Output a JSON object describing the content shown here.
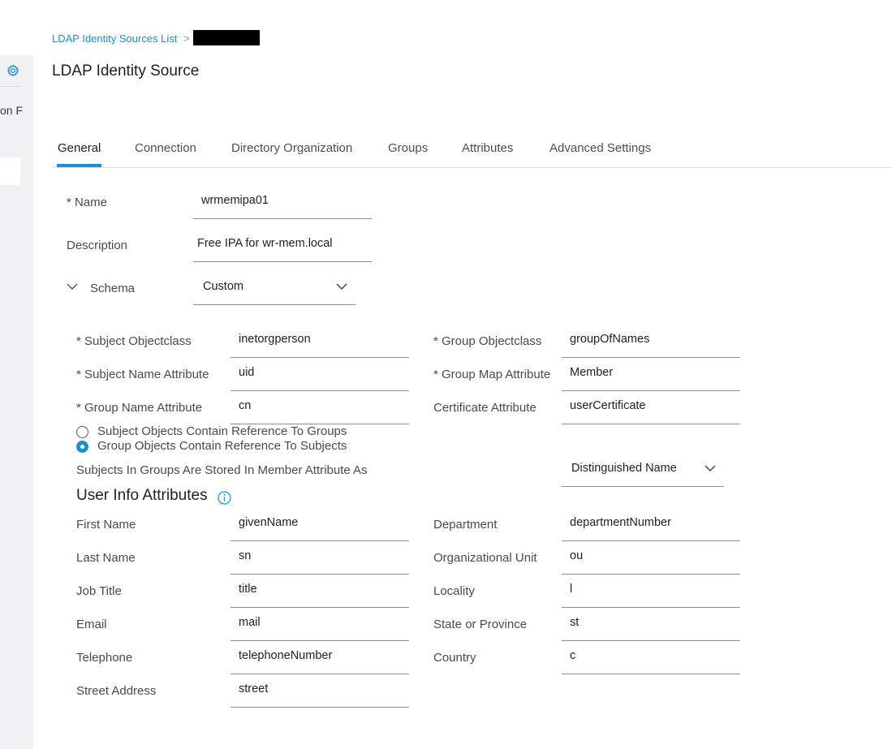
{
  "sidebar": {
    "clipped_text": "on F"
  },
  "breadcrumb": {
    "link": "LDAP Identity Sources List",
    "separator": ">"
  },
  "page_title": "LDAP Identity Source",
  "tabs": [
    {
      "label": "General",
      "active": true
    },
    {
      "label": "Connection"
    },
    {
      "label": "Directory Organization"
    },
    {
      "label": "Groups"
    },
    {
      "label": "Attributes"
    },
    {
      "label": "Advanced Settings"
    }
  ],
  "general": {
    "name_label": "* Name",
    "name_value": "wrmemipa01",
    "description_label": "Description",
    "description_value": "Free IPA for wr-mem.local",
    "schema_label": "Schema",
    "schema_value": "Custom"
  },
  "schema": {
    "subject_objectclass_label": "* Subject Objectclass",
    "subject_objectclass_value": "inetorgperson",
    "subject_name_attr_label": "* Subject Name Attribute",
    "subject_name_attr_value": "uid",
    "group_name_attr_label": "* Group Name Attribute",
    "group_name_attr_value": "cn",
    "group_objectclass_label": "* Group Objectclass",
    "group_objectclass_value": "groupOfNames",
    "group_map_attr_label": "* Group Map Attribute",
    "group_map_attr_value": "Member",
    "certificate_attr_label": "Certificate Attribute",
    "certificate_attr_value": "userCertificate",
    "radio_subject_ref": "Subject Objects Contain Reference To Groups",
    "radio_group_ref": "Group Objects Contain Reference To Subjects",
    "stored_as_label": "Subjects In Groups Are Stored In Member Attribute As",
    "stored_as_value": "Distinguished Name"
  },
  "user_info": {
    "title": "User Info Attributes",
    "left": [
      {
        "label": "First Name",
        "value": "givenName"
      },
      {
        "label": "Last Name",
        "value": "sn"
      },
      {
        "label": "Job Title",
        "value": "title"
      },
      {
        "label": "Email",
        "value": "mail"
      },
      {
        "label": "Telephone",
        "value": "telephoneNumber"
      },
      {
        "label": "Street Address",
        "value": "street"
      }
    ],
    "right": [
      {
        "label": "Department",
        "value": "departmentNumber"
      },
      {
        "label": "Organizational Unit",
        "value": "ou"
      },
      {
        "label": "Locality",
        "value": "l"
      },
      {
        "label": "State or Province",
        "value": "st"
      },
      {
        "label": "Country",
        "value": "c"
      }
    ]
  }
}
